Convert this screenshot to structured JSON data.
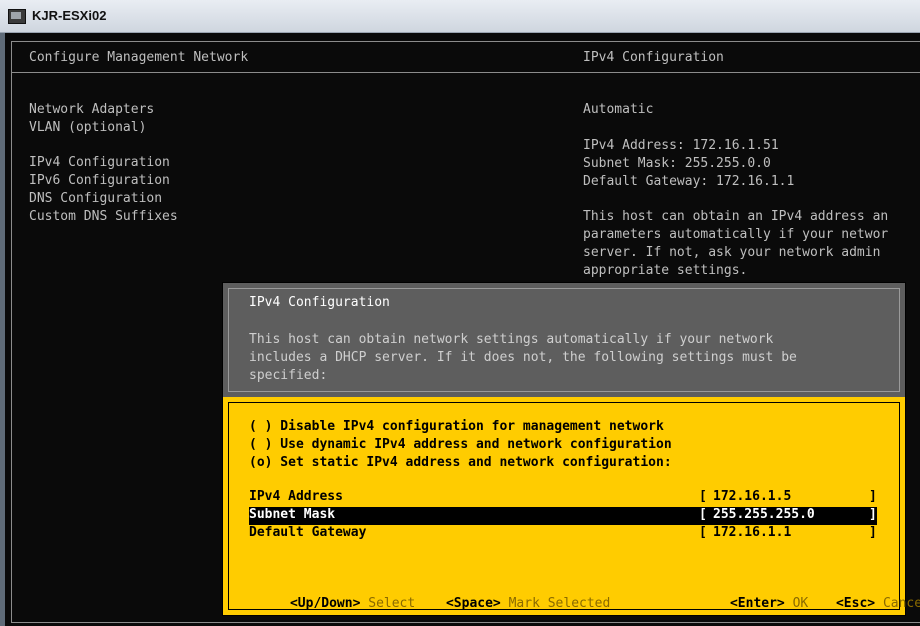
{
  "window": {
    "title": "KJR-ESXi02"
  },
  "left_panel": {
    "title": "Configure Management Network",
    "menu": [
      "Network Adapters",
      "VLAN (optional)",
      "IPv4 Configuration",
      "IPv6 Configuration",
      "DNS Configuration",
      "Custom DNS Suffixes"
    ]
  },
  "right_panel": {
    "title": "IPv4 Configuration",
    "mode": "Automatic",
    "info": [
      "IPv4 Address: 172.16.1.51",
      "Subnet Mask: 255.255.0.0",
      "Default Gateway: 172.16.1.1"
    ],
    "description": [
      "This host can obtain an IPv4 address an",
      "parameters automatically if your networ",
      "server. If not, ask your network admin",
      "appropriate settings."
    ]
  },
  "dialog": {
    "title": "IPv4 Configuration",
    "description": [
      "This host can obtain network settings automatically if your network",
      "includes a DHCP server. If it does not, the following settings must be",
      "specified:"
    ],
    "options": [
      "( ) Disable IPv4 configuration for management network",
      "( ) Use dynamic IPv4 address and network configuration",
      "(o) Set static IPv4 address and network configuration:"
    ],
    "selected_option_index": 2,
    "fields": [
      {
        "label": "IPv4 Address",
        "value": "172.16.1.5"
      },
      {
        "label": "Subnet Mask",
        "value": "255.255.255.0"
      },
      {
        "label": "Default Gateway",
        "value": "172.16.1.1"
      }
    ],
    "highlighted_field_index": 1,
    "bracket_open": "[",
    "bracket_close": "]",
    "footer": {
      "updown_key": "<Up/Down>",
      "updown_action": "Select",
      "space_key": "<Space>",
      "space_action": "Mark Selected",
      "enter_key": "<Enter>",
      "enter_action": "OK",
      "esc_key": "<Esc>",
      "esc_action": "Cancel"
    }
  },
  "colors": {
    "console_bg": "#0a0a0a",
    "console_text": "#bfbfbf",
    "dialog_header_bg": "#5e5e5e",
    "dialog_body_bg": "#ffcc00",
    "footer_action_text": "#8a6a00"
  }
}
